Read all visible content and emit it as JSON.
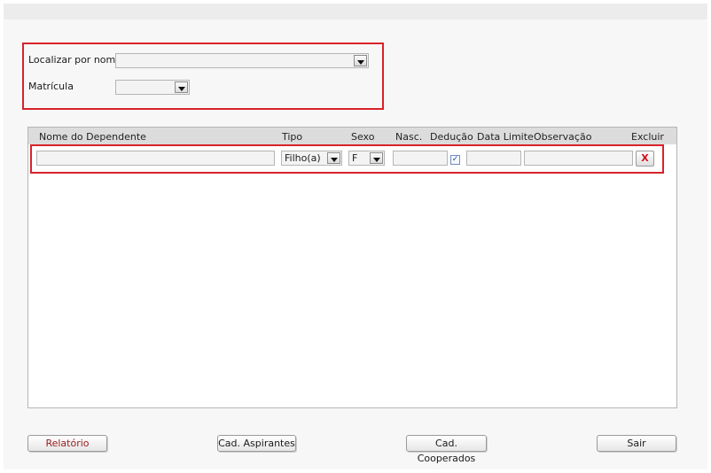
{
  "search": {
    "name_label": "Localizar por nome",
    "name_value": "",
    "matricula_label": "Matrícula",
    "matricula_value": ""
  },
  "grid": {
    "columns": [
      "Nome do Dependente",
      "Tipo",
      "Sexo",
      "Nasc.",
      "Dedução",
      "Data Limite",
      "Observação",
      "Excluir"
    ],
    "rows": [
      {
        "nome": "",
        "tipo": "Filho(a)",
        "sexo": "F",
        "nasc": "",
        "deducao": true,
        "deducao_mark": "✓",
        "data_limite": "",
        "observacao": "",
        "excluir_label": "X"
      }
    ]
  },
  "buttons": {
    "relatorio": "Relatório",
    "aspirantes": "Cad. Aspirantes",
    "cooperados": "Cad. Cooperados",
    "sair": "Sair"
  },
  "colors": {
    "highlight": "#d8222a",
    "delete": "#d0101a"
  }
}
